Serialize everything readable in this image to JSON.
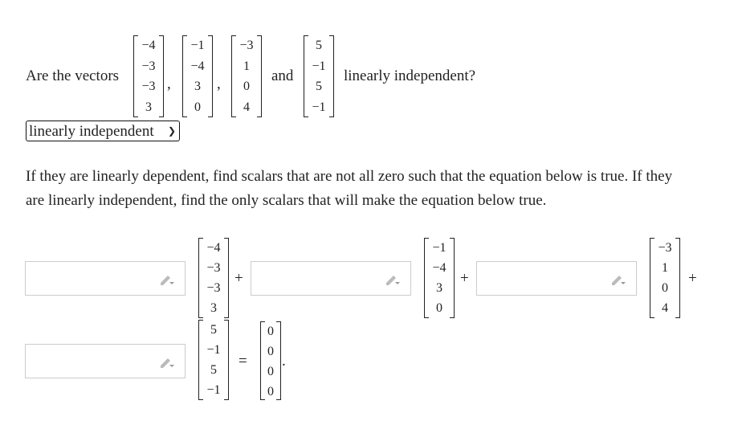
{
  "question": {
    "prefix": "Are the vectors",
    "comma": ",",
    "and": "and",
    "suffix": "linearly independent?"
  },
  "vectors": [
    [
      "−4",
      "−3",
      "−3",
      "3"
    ],
    [
      "−1",
      "−4",
      "3",
      "0"
    ],
    [
      "−3",
      "1",
      "0",
      "4"
    ],
    [
      "5",
      "−1",
      "5",
      "−1"
    ]
  ],
  "zero_vector": [
    "0",
    "0",
    "0",
    "0"
  ],
  "select": {
    "value": "linearly independent"
  },
  "instructions": [
    "If they are linearly dependent, find scalars that are not all zero such that the equation below is true. If they",
    "are linearly independent, find the only scalars that will make the equation below true."
  ],
  "equation": {
    "plus": "+",
    "equals": "=",
    "period": ".",
    "inputs": [
      "",
      "",
      "",
      ""
    ]
  }
}
